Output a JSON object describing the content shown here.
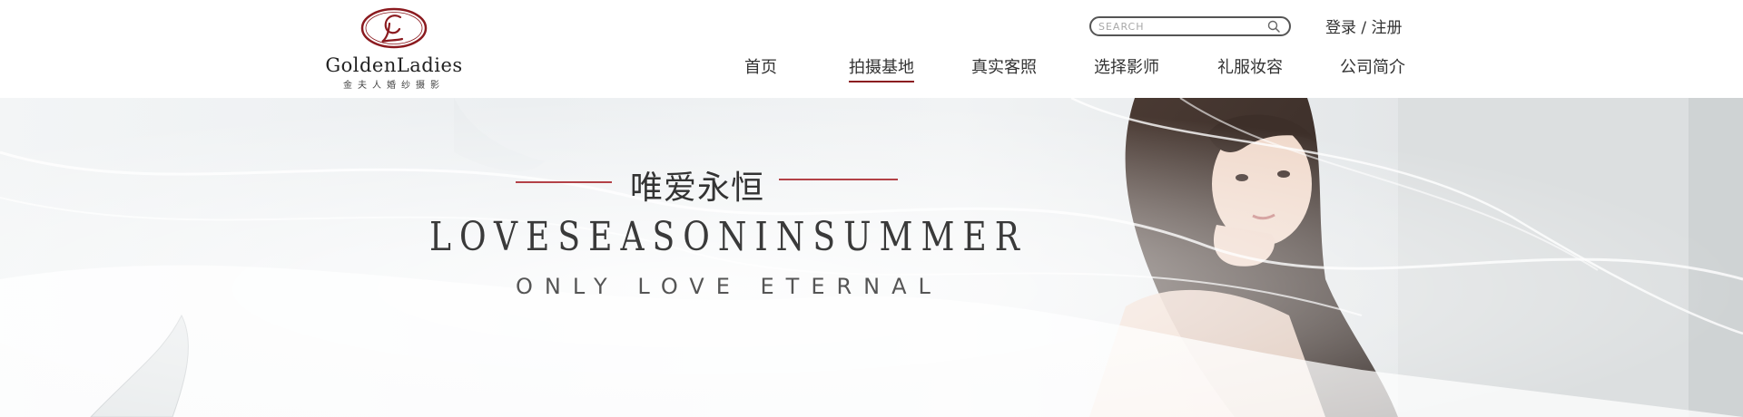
{
  "logo": {
    "name": "GOLDENLADIES",
    "name_display": "GoldenLadies",
    "subtitle": "金夫人婚纱摄影"
  },
  "search": {
    "placeholder": "SEARCH"
  },
  "auth": {
    "login": "登录",
    "separator": " / ",
    "register": "注册"
  },
  "nav": {
    "items": [
      {
        "label": "首页"
      },
      {
        "label": "拍摄基地",
        "active": true
      },
      {
        "label": "真实客照"
      },
      {
        "label": "选择影师"
      },
      {
        "label": "礼服妆容"
      },
      {
        "label": "公司简介"
      }
    ]
  },
  "hero": {
    "title_cn": "唯爱永恒",
    "title_en": "LOVESEASONINSUMMER",
    "subtitle": "ONLY LOVE ETERNAL"
  },
  "colors": {
    "accent": "#8b1a1f",
    "line": "#b34147"
  }
}
